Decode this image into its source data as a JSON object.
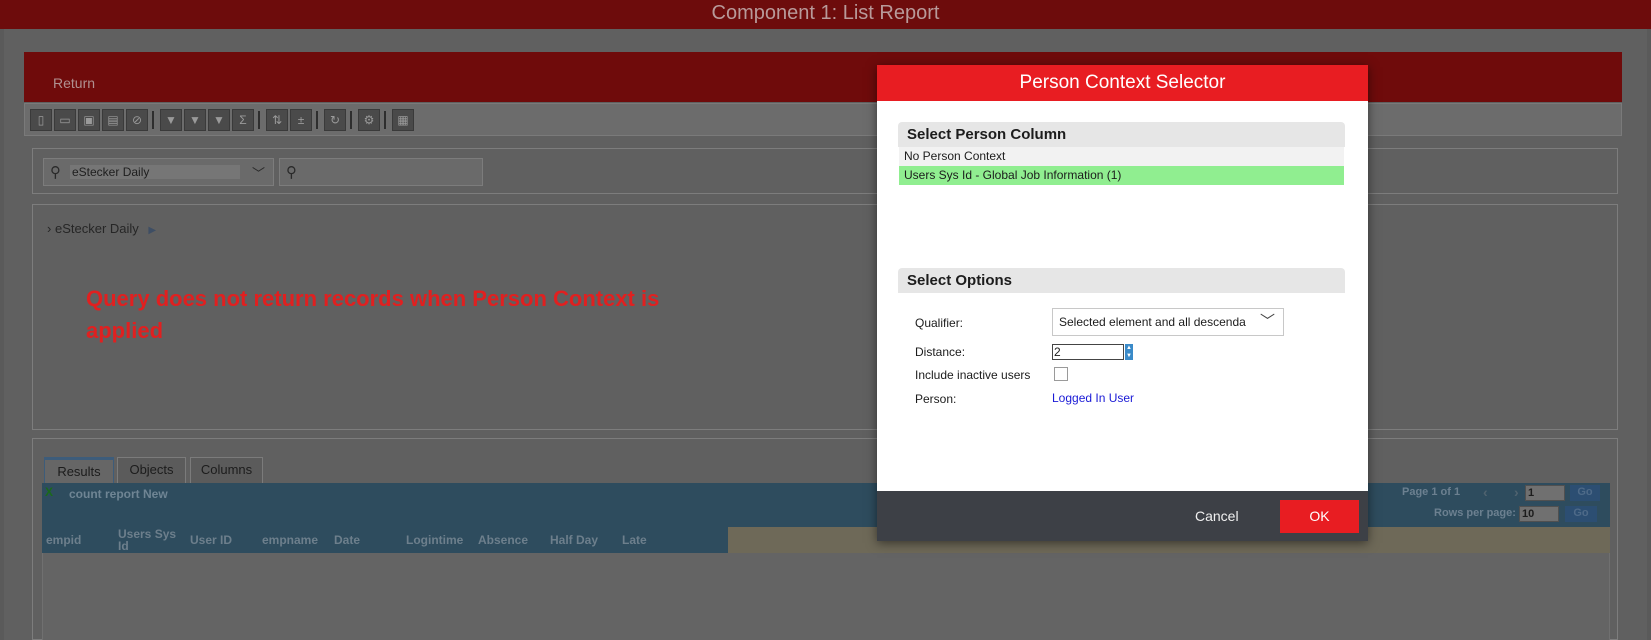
{
  "app": {
    "title": "Component 1: List Report"
  },
  "header": {
    "return_label": "Return"
  },
  "toolbar": {
    "icons": [
      "new-icon",
      "open-icon",
      "save-icon",
      "save-as-icon",
      "cancel-icon",
      "filter-icon",
      "filter-settings-icon",
      "filter-clear-icon",
      "sum-icon",
      "sort-icon",
      "calc-icon",
      "refresh-icon",
      "settings-icon",
      "report-icon"
    ]
  },
  "search": {
    "query_name": "eStecker Daily",
    "search_placeholder": ""
  },
  "tree": {
    "item_label": "eStecker Daily"
  },
  "annotation": {
    "text": "Query does not return records when Person Context is applied"
  },
  "results": {
    "tabs": [
      "Results",
      "Objects",
      "Columns"
    ],
    "report_name": "count report New",
    "pager": {
      "page_info": "Page 1 of 1",
      "page_value": "1",
      "go_label": "Go",
      "rows_label": "Rows per page:",
      "rows_value": "10"
    },
    "columns": [
      "empid",
      "Users Sys Id",
      "User ID",
      "empname",
      "Date",
      "Logintime",
      "Absence",
      "Half Day",
      "Late"
    ]
  },
  "dialog": {
    "title": "Person Context Selector",
    "person_section_title": "Select Person Column",
    "person_options": [
      "No Person Context",
      "Users Sys Id - Global Job Information (1)"
    ],
    "selected_person_option": "Users Sys Id - Global Job Information (1)",
    "options_section_title": "Select Options",
    "qualifier_label": "Qualifier:",
    "qualifier_value": "Selected element and all descenda",
    "distance_label": "Distance:",
    "distance_value": "2",
    "inactive_label": "Include inactive users",
    "inactive_checked": false,
    "person_label": "Person:",
    "person_value": "Logged In User",
    "cancel_label": "Cancel",
    "ok_label": "OK"
  },
  "colors": {
    "dialog_red": "#e81d22",
    "selected_row": "#90ee90",
    "link_blue": "#1a1ad6",
    "footer": "#3d4046"
  }
}
